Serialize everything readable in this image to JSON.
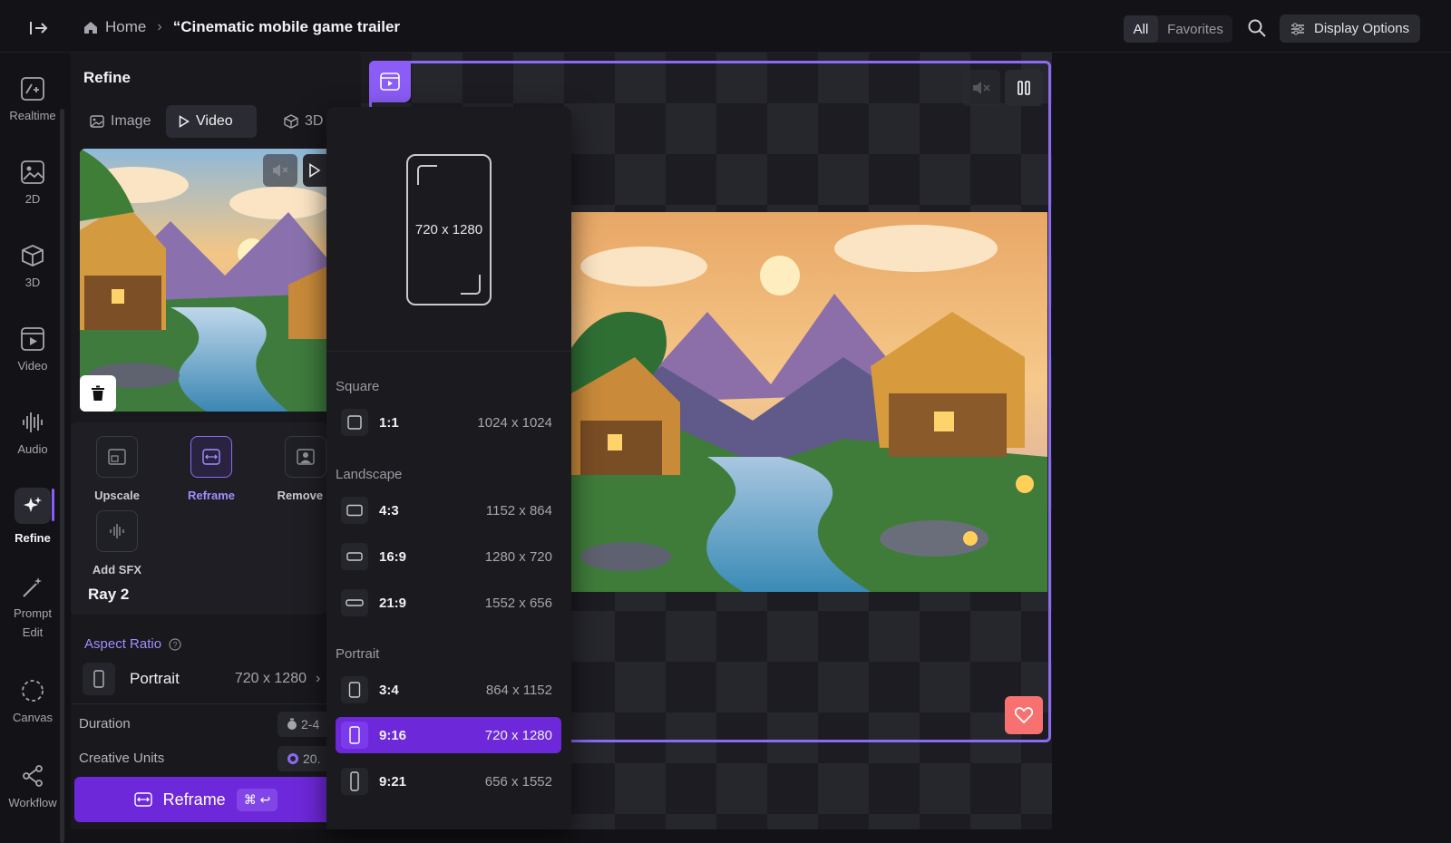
{
  "header": {
    "breadcrumb_home": "Home",
    "breadcrumb_separator": "›",
    "breadcrumb_current": "“Cinematic mobile game trailer",
    "filter_all": "All",
    "filter_favorites": "Favorites",
    "display_options": "Display Options"
  },
  "nav": {
    "items": [
      {
        "label": "Realtime",
        "icon": "realtime-icon"
      },
      {
        "label": "2D",
        "icon": "image-icon"
      },
      {
        "label": "3D",
        "icon": "cube-icon"
      },
      {
        "label": "Video",
        "icon": "video-icon"
      },
      {
        "label": "Audio",
        "icon": "audio-wave-icon"
      },
      {
        "label": "Refine",
        "icon": "sparkle-icon"
      },
      {
        "label": "Prompt",
        "label2": "Edit",
        "icon": "magic-wand-icon"
      },
      {
        "label": "Canvas",
        "icon": "canvas-icon"
      },
      {
        "label": "Workflow",
        "icon": "share-icon"
      }
    ]
  },
  "refine": {
    "title": "Refine",
    "tabs": [
      {
        "label": "Image",
        "icon": "image-icon"
      },
      {
        "label": "Video",
        "icon": "play-icon"
      },
      {
        "label": "3D",
        "icon": "cube-icon"
      }
    ],
    "tools": [
      {
        "label": "Upscale"
      },
      {
        "label": "Reframe"
      },
      {
        "label": "Remove E"
      },
      {
        "label": "Add SFX"
      }
    ],
    "model": "Ray 2",
    "aspect_ratio_label": "Aspect Ratio",
    "aspect_ratio_value": "Portrait",
    "aspect_ratio_dims": "720 x 1280",
    "duration_label": "Duration",
    "duration_value": "2-4",
    "credits_label": "Creative Units",
    "credits_value": "20.",
    "reframe_button": "Reframe",
    "shortcut": "⌘ ↩"
  },
  "dropdown": {
    "preview_dims": "720 x 1280",
    "sections": [
      {
        "title": "Square",
        "items": [
          {
            "ratio": "1:1",
            "dims": "1024 x 1024"
          }
        ]
      },
      {
        "title": "Landscape",
        "items": [
          {
            "ratio": "4:3",
            "dims": "1152 x 864"
          },
          {
            "ratio": "16:9",
            "dims": "1280 x 720"
          },
          {
            "ratio": "21:9",
            "dims": "1552 x 656"
          }
        ]
      },
      {
        "title": "Portrait",
        "items": [
          {
            "ratio": "3:4",
            "dims": "864 x 1152"
          },
          {
            "ratio": "9:16",
            "dims": "720 x 1280",
            "selected": true
          },
          {
            "ratio": "9:21",
            "dims": "656 x 1552"
          }
        ]
      }
    ]
  },
  "colors": {
    "accent": "#8b5cf6",
    "selected": "#6d28d9",
    "favorite": "#f87171"
  }
}
